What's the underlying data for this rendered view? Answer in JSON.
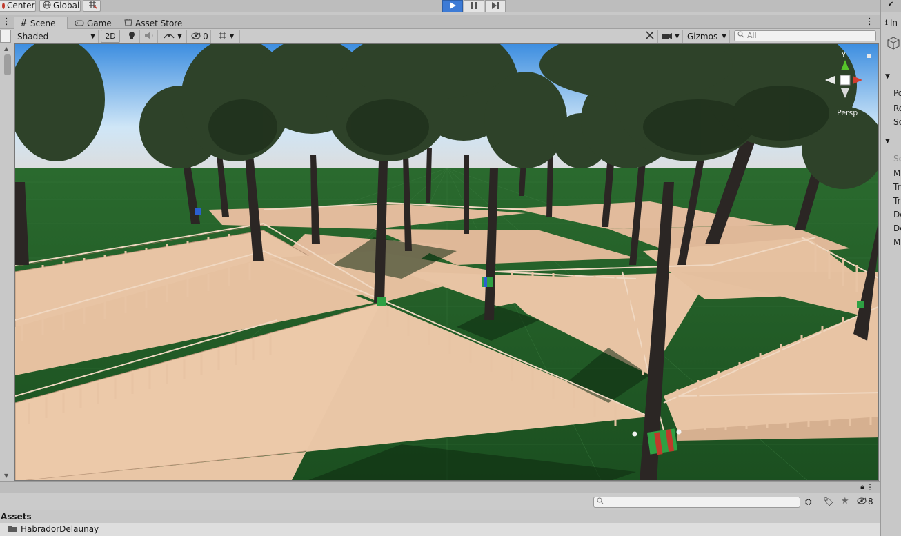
{
  "toolbar": {
    "pivot_label": "Center",
    "space_label": "Global",
    "snap_icon": "grid-snap-icon",
    "play_icon": "play-icon",
    "pause_icon": "pause-icon",
    "step_icon": "step-icon"
  },
  "scene_tabs": [
    {
      "label": "Scene",
      "icon": "grid-icon",
      "active": true
    },
    {
      "label": "Game",
      "icon": "gamepad-icon",
      "active": false
    },
    {
      "label": "Asset Store",
      "icon": "store-icon",
      "active": false
    }
  ],
  "scene_toolbar": {
    "draw_mode": "Shaded",
    "twod_label": "2D",
    "hidden_count": "0",
    "gizmos_label": "Gizmos",
    "search_placeholder": "All"
  },
  "viewport": {
    "projection_label": "Persp",
    "axis_y_label": "y",
    "sky_top": "#3d8ee0",
    "ground_color": "#1f5a24",
    "platform_color": "#e8c4a4"
  },
  "project": {
    "hidden_count": "8",
    "assets_header": "Assets",
    "folders": [
      "HabradorDelaunay"
    ]
  },
  "inspector": {
    "tab_label": "In",
    "rows": [
      "Po",
      "Ro",
      "Sc",
      "Sc",
      "M",
      "Tr",
      "Tr",
      "De",
      "De",
      "M"
    ]
  }
}
